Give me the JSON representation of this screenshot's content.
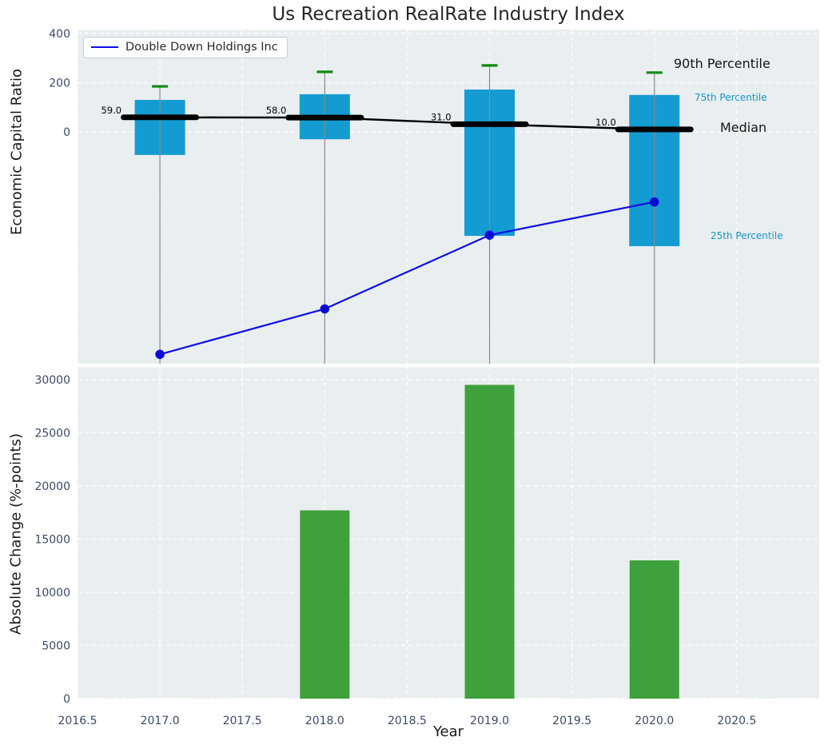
{
  "title": "Us Recreation RealRate Industry Index",
  "legend": {
    "label": "Double Down Holdings Inc"
  },
  "annotations": {
    "p90": "90th Percentile",
    "p75": "75th Percentile",
    "median": "Median",
    "p25": "25th Percentile"
  },
  "top_axes": {
    "ylabel": "Economic Capital Ratio",
    "yticks": [
      0,
      200,
      400
    ],
    "ytick_labels": [
      "0",
      "200",
      "400"
    ],
    "ylim": [
      -943,
      416
    ]
  },
  "bottom_axes": {
    "ylabel": "Absolute Change (%-points)",
    "xlabel": "Year",
    "yticks": [
      0,
      5000,
      10000,
      15000,
      20000,
      25000,
      30000
    ],
    "ytick_labels": [
      "0",
      "5000",
      "10000",
      "15000",
      "20000",
      "25000",
      "30000"
    ],
    "xticks": [
      2016.5,
      2017.0,
      2017.5,
      2018.0,
      2018.5,
      2019.0,
      2019.5,
      2020.0,
      2020.5
    ],
    "xtick_labels": [
      "2016.5",
      "2017.0",
      "2017.5",
      "2018.0",
      "2018.5",
      "2019.0",
      "2019.5",
      "2020.0",
      "2020.5"
    ],
    "ylim": [
      0,
      31150
    ],
    "xlim": [
      2016.5,
      2021.0
    ]
  },
  "colors": {
    "plot_bg": "#e9eef0",
    "grid": "#fdfdfd",
    "box_fill": "#149bd1",
    "cap_green": "#118a11",
    "whisker_gray": "#8a8a8a",
    "median_black": "#000000",
    "company_blue": "#0d0de8",
    "marker_blue": "#0b0bd0",
    "bar_green": "#3fa13c",
    "tick_text": "#3b4a68",
    "percentile_text": "#1496c8"
  },
  "chart_data": [
    {
      "type": "boxplot",
      "title": "Us Recreation RealRate Industry Index",
      "ylabel": "Economic Capital Ratio",
      "x": [
        2017,
        2018,
        2019,
        2020
      ],
      "xlim": [
        2016.5,
        2021.0
      ],
      "ylim": [
        -943,
        416
      ],
      "yticks": [
        0,
        200,
        400
      ],
      "grid": true,
      "legend_position": "upper left",
      "whiskers_clipped_to_bottom": true,
      "series": [
        {
          "name": "90th Percentile",
          "role": "cap",
          "values": [
            185,
            244,
            270,
            241
          ]
        },
        {
          "name": "75th Percentile",
          "role": "box_top",
          "values": [
            130,
            153,
            172,
            150
          ]
        },
        {
          "name": "Median",
          "role": "median_line",
          "values": [
            59,
            58,
            31,
            10
          ],
          "labels": [
            "59.0",
            "58.0",
            "31.0",
            "10.0"
          ]
        },
        {
          "name": "25th Percentile",
          "role": "box_bottom",
          "values": [
            -94,
            -30,
            -423,
            -465
          ]
        },
        {
          "name": "Double Down Holdings Inc",
          "role": "line_markers",
          "values": [
            -905,
            -720,
            -420,
            -285
          ]
        }
      ]
    },
    {
      "type": "bar",
      "ylabel": "Absolute Change (%-points)",
      "xlabel": "Year",
      "categories": [
        2018,
        2019,
        2020
      ],
      "values": [
        17700,
        29500,
        13000
      ],
      "xlim": [
        2016.5,
        2021.0
      ],
      "ylim": [
        0,
        31150
      ],
      "yticks": [
        0,
        5000,
        10000,
        15000,
        20000,
        25000,
        30000
      ],
      "grid": true
    }
  ]
}
